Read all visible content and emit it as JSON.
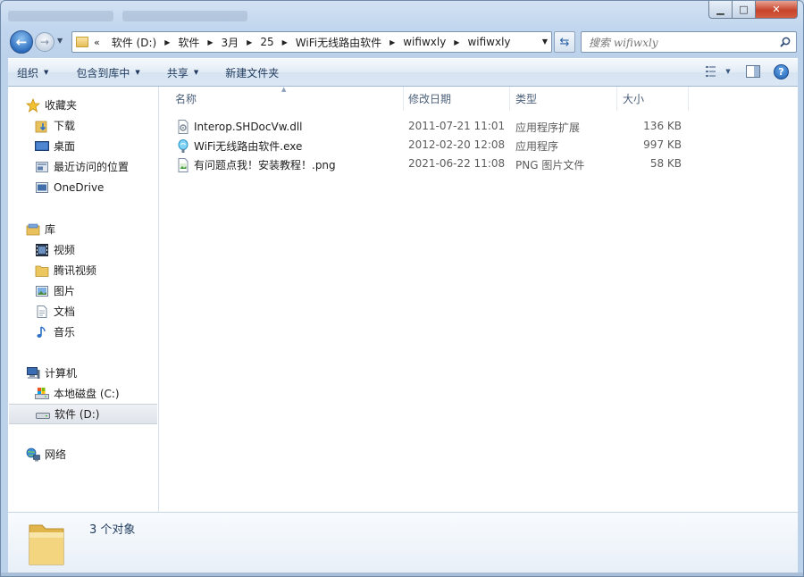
{
  "window": {
    "caption_buttons": {
      "minimize": "▁",
      "maximize": "□",
      "close": "✕"
    }
  },
  "address_bar": {
    "lead": "«",
    "crumbs": [
      "软件 (D:)",
      "软件",
      "3月",
      "25",
      "WiFi无线路由软件",
      "wifiwxly",
      "wifiwxly"
    ]
  },
  "search": {
    "placeholder": "搜索 wifiwxly"
  },
  "toolbar": {
    "organize": "组织",
    "include_in_library": "包含到库中",
    "share": "共享",
    "new_folder": "新建文件夹"
  },
  "nav": {
    "favorites": "收藏夹",
    "favorites_items": [
      "下载",
      "桌面",
      "最近访问的位置",
      "OneDrive"
    ],
    "libraries": "库",
    "libraries_items": [
      "视频",
      "腾讯视频",
      "图片",
      "文档",
      "音乐"
    ],
    "computer": "计算机",
    "computer_items": [
      "本地磁盘 (C:)",
      "软件 (D:)"
    ],
    "network": "网络"
  },
  "columns": {
    "name": "名称",
    "modified": "修改日期",
    "type": "类型",
    "size": "大小"
  },
  "files": [
    {
      "name": "Interop.SHDocVw.dll",
      "modified": "2011-07-21 11:01",
      "type": "应用程序扩展",
      "size": "136 KB",
      "icon": "dll-gear-icon"
    },
    {
      "name": "WiFi无线路由软件.exe",
      "modified": "2012-02-20 12:08",
      "type": "应用程序",
      "size": "997 KB",
      "icon": "wifi-app-icon"
    },
    {
      "name": "有问题点我！安装教程！.png",
      "modified": "2021-06-22 11:08",
      "type": "PNG 图片文件",
      "size": "58 KB",
      "icon": "png-image-icon"
    }
  ],
  "details": {
    "count": "3 个对象"
  },
  "colors": {
    "accent": "#1e395b",
    "selection": "#dfe4ea",
    "folder": "#e6bd57"
  }
}
